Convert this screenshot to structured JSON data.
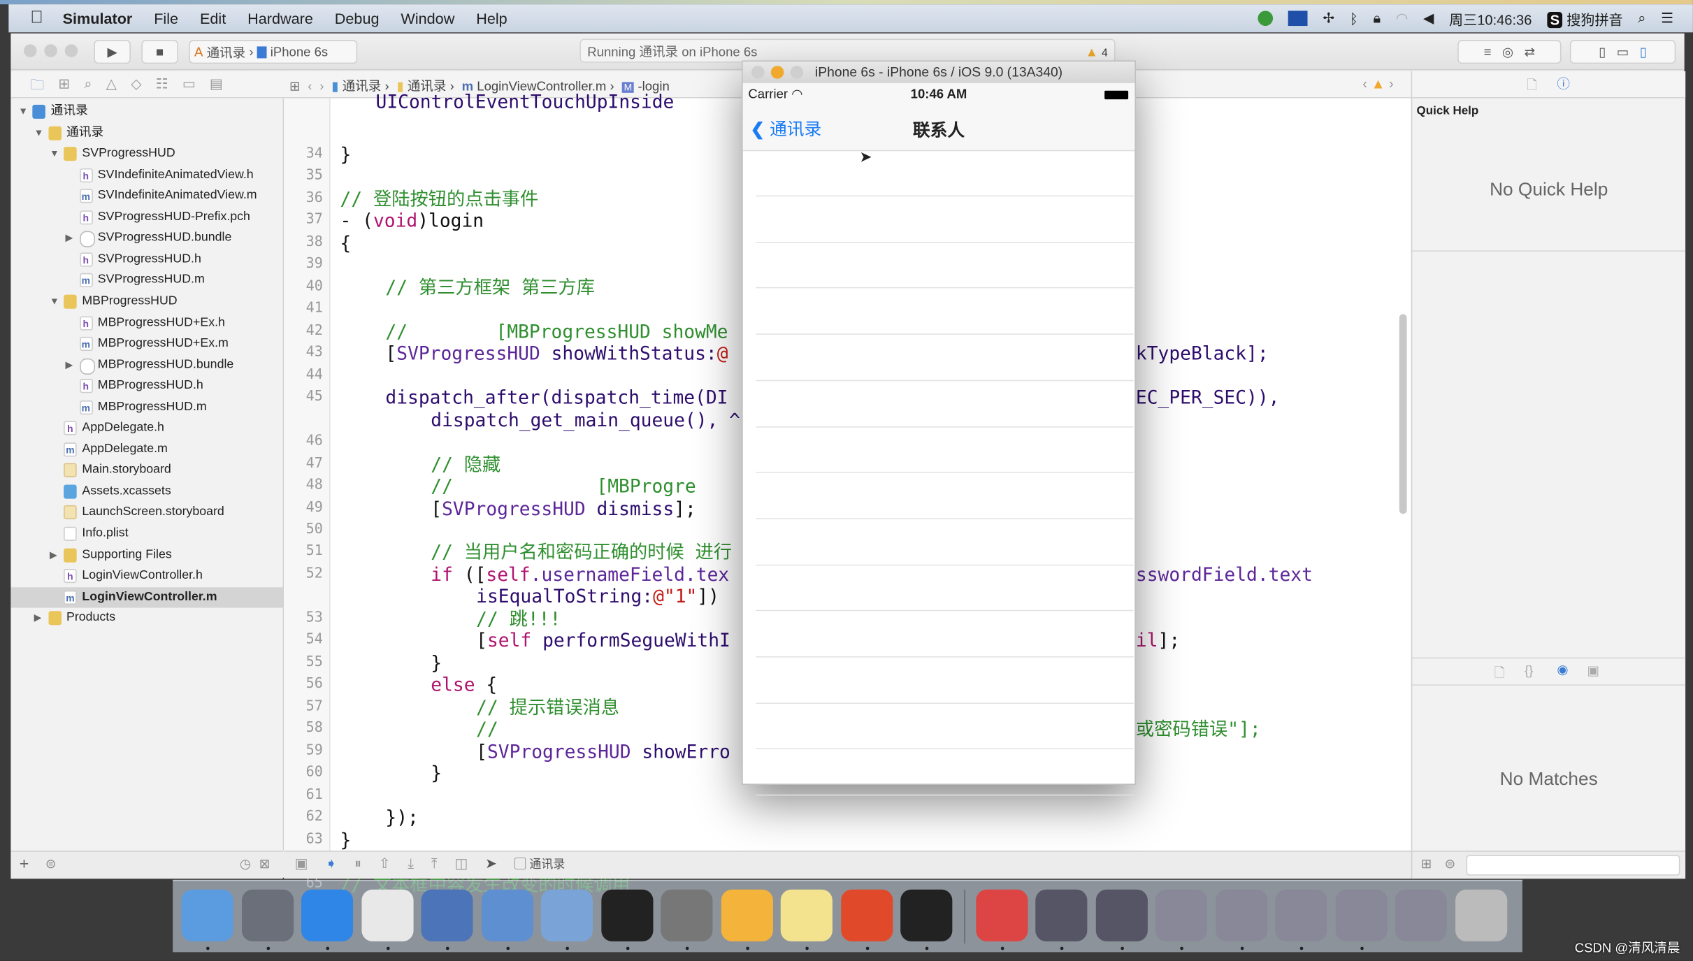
{
  "menubar": {
    "apple_icon": "apple-icon",
    "items": [
      "Simulator",
      "File",
      "Edit",
      "Hardware",
      "Debug",
      "Window",
      "Help"
    ],
    "clock": "周三10:46:36",
    "input_method": "搜狗拼音"
  },
  "toolbar": {
    "scheme": "通讯录",
    "device": "iPhone 6s",
    "activity": "Running 通讯录 on iPhone 6s",
    "warning_count": "4"
  },
  "jumpbar": {
    "items": [
      "通讯录",
      "通讯录",
      "LoginViewController.m",
      "-login"
    ]
  },
  "navigator": {
    "items": [
      {
        "label": "通讯录",
        "depth": 0,
        "icon": "project",
        "disclosure": "open"
      },
      {
        "label": "通讯录",
        "depth": 1,
        "icon": "folder",
        "disclosure": "open"
      },
      {
        "label": "SVProgressHUD",
        "depth": 2,
        "icon": "folder",
        "disclosure": "open"
      },
      {
        "label": "SVIndefiniteAnimatedView.h",
        "depth": 3,
        "icon": "h"
      },
      {
        "label": "SVIndefiniteAnimatedView.m",
        "depth": 3,
        "icon": "m"
      },
      {
        "label": "SVProgressHUD-Prefix.pch",
        "depth": 3,
        "icon": "h"
      },
      {
        "label": "SVProgressHUD.bundle",
        "depth": 3,
        "icon": "bundle",
        "disclosure": "closed"
      },
      {
        "label": "SVProgressHUD.h",
        "depth": 3,
        "icon": "h"
      },
      {
        "label": "SVProgressHUD.m",
        "depth": 3,
        "icon": "m"
      },
      {
        "label": "MBProgressHUD",
        "depth": 2,
        "icon": "folder",
        "disclosure": "open"
      },
      {
        "label": "MBProgressHUD+Ex.h",
        "depth": 3,
        "icon": "h"
      },
      {
        "label": "MBProgressHUD+Ex.m",
        "depth": 3,
        "icon": "m"
      },
      {
        "label": "MBProgressHUD.bundle",
        "depth": 3,
        "icon": "bundle",
        "disclosure": "closed"
      },
      {
        "label": "MBProgressHUD.h",
        "depth": 3,
        "icon": "h"
      },
      {
        "label": "MBProgressHUD.m",
        "depth": 3,
        "icon": "m"
      },
      {
        "label": "AppDelegate.h",
        "depth": 2,
        "icon": "h"
      },
      {
        "label": "AppDelegate.m",
        "depth": 2,
        "icon": "m"
      },
      {
        "label": "Main.storyboard",
        "depth": 2,
        "icon": "sb"
      },
      {
        "label": "Assets.xcassets",
        "depth": 2,
        "icon": "xc"
      },
      {
        "label": "LaunchScreen.storyboard",
        "depth": 2,
        "icon": "sb"
      },
      {
        "label": "Info.plist",
        "depth": 2,
        "icon": "plist"
      },
      {
        "label": "Supporting Files",
        "depth": 2,
        "icon": "folder",
        "disclosure": "closed"
      },
      {
        "label": "LoginViewController.h",
        "depth": 2,
        "icon": "h"
      },
      {
        "label": "LoginViewController.m",
        "depth": 2,
        "icon": "m",
        "selected": true
      },
      {
        "label": "Products",
        "depth": 1,
        "icon": "folder",
        "disclosure": "closed"
      }
    ]
  },
  "editor": {
    "top_partial": "UIControlEventTouchUpInside",
    "lines": [
      {
        "n": "34",
        "indent": 0,
        "seg": [
          [
            "}",
            "plain"
          ]
        ]
      },
      {
        "n": "35",
        "indent": 0,
        "seg": []
      },
      {
        "n": "36",
        "indent": 0,
        "seg": [
          [
            "// 登陆按钮的点击事件",
            "comment"
          ]
        ]
      },
      {
        "n": "37",
        "indent": 0,
        "seg": [
          [
            "- (",
            "plain"
          ],
          [
            "void",
            "keyword"
          ],
          [
            ")login",
            "plain"
          ]
        ]
      },
      {
        "n": "38",
        "indent": 0,
        "seg": [
          [
            "{",
            "plain"
          ]
        ]
      },
      {
        "n": "39",
        "indent": 0,
        "seg": []
      },
      {
        "n": "40",
        "indent": 1,
        "seg": [
          [
            "// 第三方框架 第三方库",
            "comment"
          ]
        ]
      },
      {
        "n": "41",
        "indent": 1,
        "seg": []
      },
      {
        "n": "42",
        "indent": 1,
        "seg": [
          [
            "//        [MBProgressHUD showMe",
            "comment"
          ]
        ]
      },
      {
        "n": "43",
        "indent": 1,
        "seg": [
          [
            "[",
            "plain"
          ],
          [
            "SVProgressHUD",
            "class"
          ],
          [
            " showWithStatus:",
            "method"
          ],
          [
            "@",
            "string"
          ]
        ],
        "right": [
          [
            "kTypeBlack];",
            "method"
          ]
        ]
      },
      {
        "n": "44",
        "indent": 1,
        "seg": []
      },
      {
        "n": "45",
        "indent": 1,
        "seg": [
          [
            "dispatch_after(dispatch_time(DI",
            "method"
          ]
        ],
        "right": [
          [
            "EC_PER_SEC)),",
            "method"
          ]
        ]
      },
      {
        "n": "",
        "indent": 2,
        "seg": [
          [
            "dispatch_get_main_queue(), ^",
            "method"
          ]
        ]
      },
      {
        "n": "46",
        "indent": 2,
        "seg": []
      },
      {
        "n": "47",
        "indent": 2,
        "seg": [
          [
            "// 隐藏",
            "comment"
          ]
        ]
      },
      {
        "n": "48",
        "indent": 2,
        "seg": [
          [
            "//             [MBProgre",
            "comment"
          ]
        ]
      },
      {
        "n": "49",
        "indent": 2,
        "seg": [
          [
            "[",
            "plain"
          ],
          [
            "SVProgressHUD",
            "class"
          ],
          [
            " dismiss",
            "method"
          ],
          [
            "];",
            "plain"
          ]
        ]
      },
      {
        "n": "50",
        "indent": 2,
        "seg": []
      },
      {
        "n": "51",
        "indent": 2,
        "seg": [
          [
            "// 当用户名和密码正确的时候 进行",
            "comment"
          ]
        ]
      },
      {
        "n": "52",
        "indent": 2,
        "seg": [
          [
            "if",
            "keyword"
          ],
          [
            " ([",
            "plain"
          ],
          [
            "self",
            "keyword"
          ],
          [
            ".usernameField.tex",
            "class"
          ]
        ],
        "right": [
          [
            "sswordField",
            "class"
          ],
          [
            ".text",
            "class"
          ]
        ]
      },
      {
        "n": "",
        "indent": 3,
        "seg": [
          [
            "isEqualToString:",
            "method"
          ],
          [
            "@\"1\"",
            "string"
          ],
          [
            "]) ",
            "plain"
          ]
        ]
      },
      {
        "n": "53",
        "indent": 3,
        "seg": [
          [
            "// 跳!!!",
            "comment"
          ]
        ]
      },
      {
        "n": "54",
        "indent": 3,
        "seg": [
          [
            "[",
            "plain"
          ],
          [
            "self",
            "keyword"
          ],
          [
            " performSegueWithI",
            "method"
          ]
        ],
        "right": [
          [
            "il",
            "keyword"
          ],
          [
            "];",
            "plain"
          ]
        ]
      },
      {
        "n": "55",
        "indent": 2,
        "seg": [
          [
            "}",
            "plain"
          ]
        ]
      },
      {
        "n": "56",
        "indent": 2,
        "seg": [
          [
            "else",
            "keyword"
          ],
          [
            " {",
            "plain"
          ]
        ]
      },
      {
        "n": "57",
        "indent": 3,
        "seg": [
          [
            "// 提示错误消息",
            "comment"
          ]
        ]
      },
      {
        "n": "58",
        "indent": 3,
        "seg": [
          [
            "//",
            "comment"
          ]
        ],
        "right": [
          [
            "或密码错误\"];",
            "comment"
          ]
        ]
      },
      {
        "n": "59",
        "indent": 3,
        "seg": [
          [
            "[",
            "plain"
          ],
          [
            "SVProgressHUD",
            "class"
          ],
          [
            " showErro",
            "method"
          ]
        ]
      },
      {
        "n": "60",
        "indent": 2,
        "seg": [
          [
            "}",
            "plain"
          ]
        ]
      },
      {
        "n": "61",
        "indent": 1,
        "seg": []
      },
      {
        "n": "62",
        "indent": 1,
        "seg": [
          [
            "});",
            "plain"
          ]
        ]
      },
      {
        "n": "63",
        "indent": 0,
        "seg": [
          [
            "}",
            "plain"
          ]
        ]
      },
      {
        "n": "64",
        "indent": 0,
        "seg": []
      },
      {
        "n": "65",
        "indent": 0,
        "seg": [
          [
            "// 文本框中容发生改变的时候调用",
            "comment"
          ]
        ]
      }
    ]
  },
  "inspector": {
    "title": "Quick Help",
    "empty_help": "No Quick Help",
    "empty_library": "No Matches"
  },
  "debugbar": {
    "target": "通讯录"
  },
  "simulator": {
    "title": "iPhone 6s - iPhone 6s / iOS 9.0 (13A340)",
    "carrier": "Carrier",
    "time": "10:46 AM",
    "back_label": "通讯录",
    "nav_title": "联系人",
    "row_count": 14
  },
  "dock": {
    "apps": [
      "Finder",
      "Launchpad",
      "Safari",
      "Mouse",
      "Keynote",
      "Xcode",
      "Instruments",
      "Terminal",
      "System Preferences",
      "Sketch",
      "Notes",
      "WPS",
      "Exec",
      "QuickTime",
      "Screens",
      "Screens",
      "Screens",
      "Screens",
      "Screens",
      "Screens",
      "Screens",
      "Trash"
    ]
  },
  "watermark": "CSDN @清风清晨",
  "colors": {
    "comment": "#2f8f2f",
    "keyword": "#b0136f",
    "class": "#5c2699",
    "string": "#c41a16",
    "ios_tint": "#1a7cf5",
    "warning": "#f0a92c"
  }
}
